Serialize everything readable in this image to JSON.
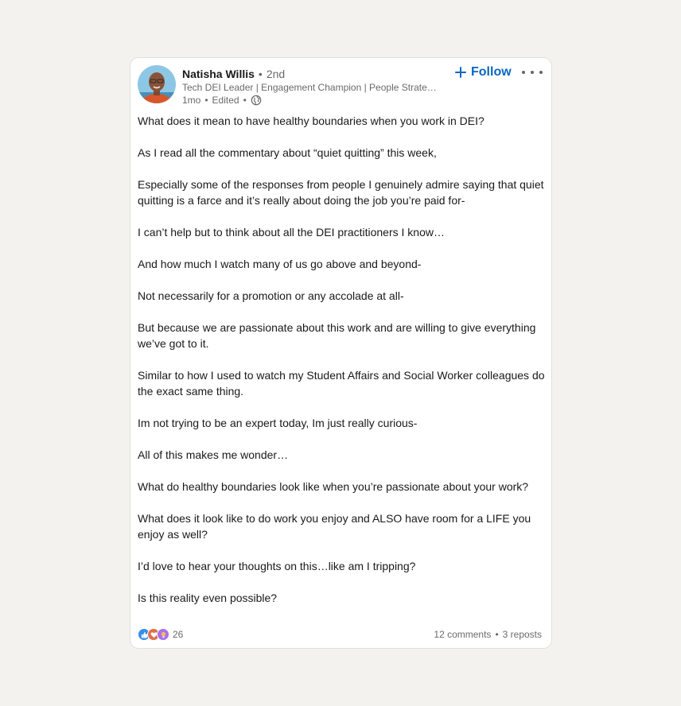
{
  "post": {
    "actor": {
      "name": "Natisha Willis",
      "degree": "2nd",
      "headline": "Tech DEI Leader | Engagement Champion | People Strategy Expert",
      "time": "1mo",
      "edited": "Edited",
      "bullet": "•"
    },
    "follow_label": "Follow",
    "body": [
      "What does it mean to have healthy boundaries when you work in DEI?",
      "As I read all the commentary about “quiet quitting” this week,",
      "Especially some of the responses from people I genuinely admire saying that quiet quitting is a farce and it’s really about doing the job you’re paid for-",
      "I can’t help but to think about all the DEI practitioners I know…",
      "And how much I watch many of us go above and beyond-",
      "Not necessarily for a promotion or any accolade at all-",
      "But because we are passionate about this work and are willing to give everything we’ve got to it.",
      "Similar to how I used to watch my Student Affairs and Social Worker colleagues do the exact same thing.",
      "Im not trying to be an expert today, Im just really curious-",
      "All of this makes me wonder…",
      "What do healthy boundaries look like when you’re passionate about your work?",
      "What does it look like to do work you enjoy and ALSO have room for a LIFE you enjoy as well?",
      "I’d love to hear your thoughts on this…like am I tripping?",
      "Is this reality even possible?"
    ],
    "social": {
      "reaction_count": "26",
      "comments": "12 comments",
      "reposts": "3 reposts",
      "bullet": "•"
    },
    "colors": {
      "accent": "#0a66c2",
      "background": "#f3f2ef",
      "card": "#ffffff"
    },
    "icons": {
      "globe": "globe-icon",
      "plus": "plus-icon",
      "more": "more-icon",
      "reactions": [
        "like-icon",
        "love-icon",
        "insightful-icon"
      ]
    }
  }
}
